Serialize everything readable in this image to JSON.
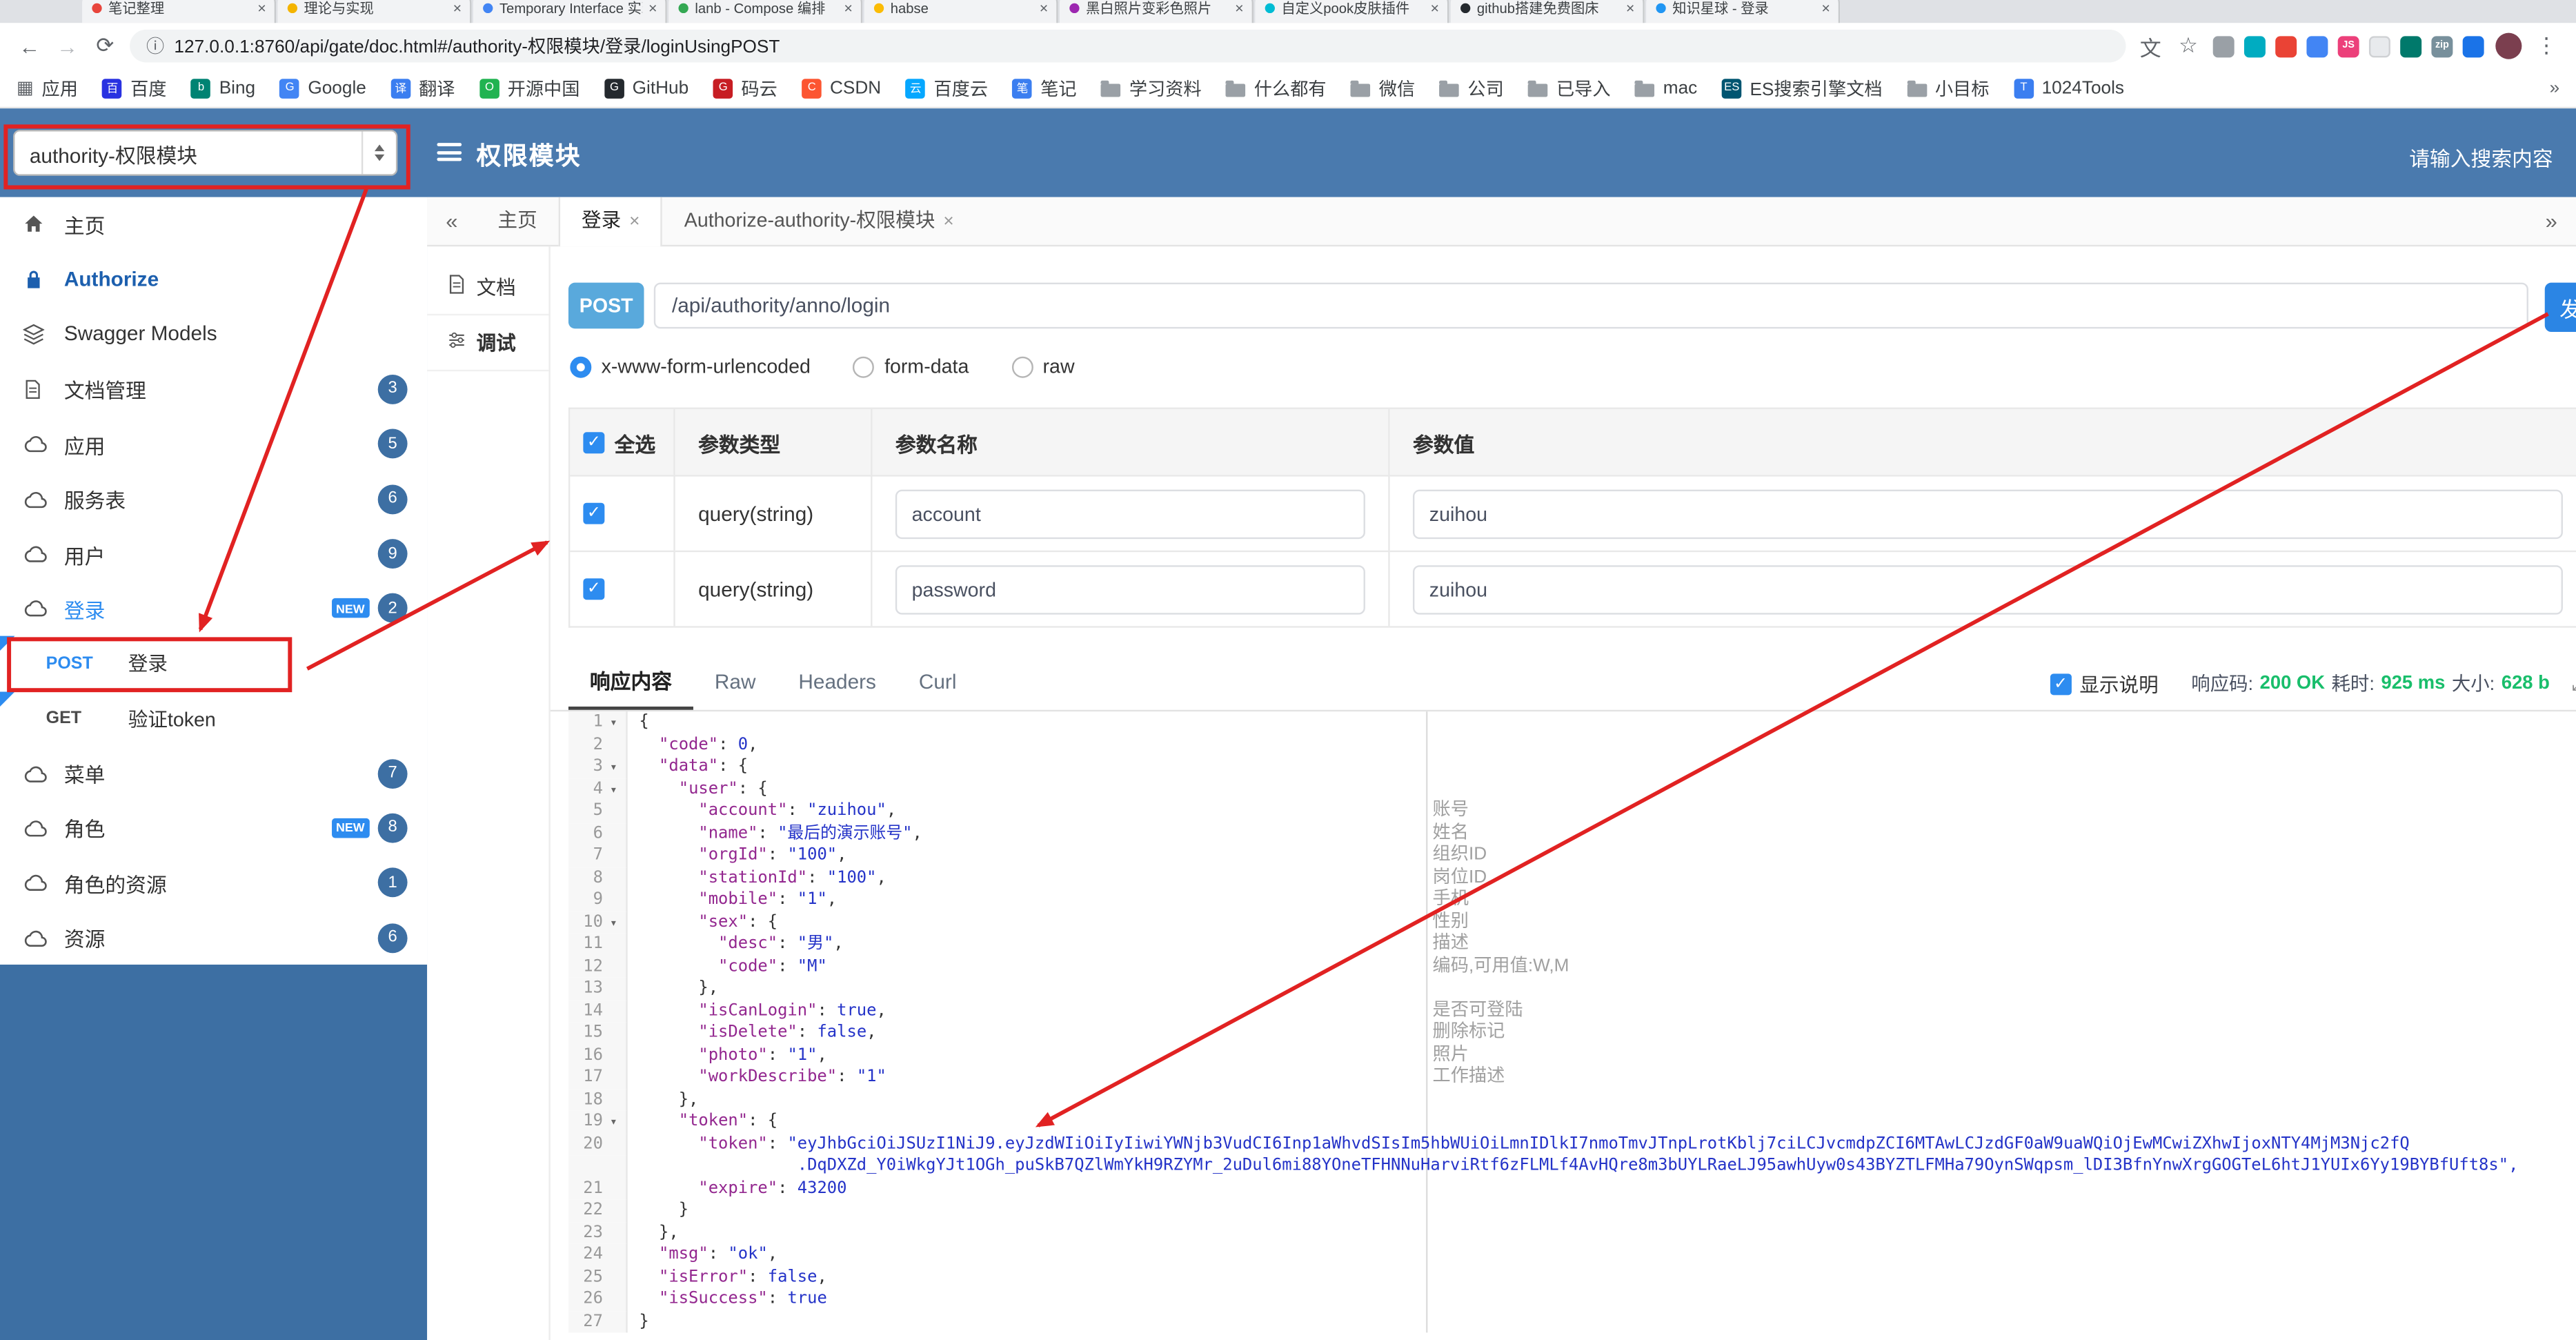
{
  "colors": {
    "accent": "#2d8cf0",
    "header_blue": "#4a7aae",
    "badge_blue": "#3d6fa3",
    "post_badge": "#59a9dc",
    "success_green": "#19be6b",
    "annotation_red": "#e12222"
  },
  "browser": {
    "tabs": [
      {
        "title": "笔记整理",
        "color": "#e8453c"
      },
      {
        "title": "理论与实现",
        "color": "#f4b400"
      },
      {
        "title": "Temporary Interface 实现",
        "color": "#4285f4"
      },
      {
        "title": "lanb - Compose 编排",
        "color": "#34a853"
      },
      {
        "title": "habse",
        "color": "#fbbc05"
      },
      {
        "title": "黑白照片变彩色照片",
        "color": "#9c27b0"
      },
      {
        "title": "自定义pook皮肤插件",
        "color": "#00bcd4"
      },
      {
        "title": "github搭建免费图床",
        "color": "#24292e"
      },
      {
        "title": "知识星球 - 登录",
        "color": "#2196f3"
      }
    ],
    "url": "127.0.0.1:8760/api/gate/doc.html#/authority-权限模块/登录/loginUsingPOST",
    "extensions": [
      {
        "color": "#9aa0a6"
      },
      {
        "color": "#00acc1"
      },
      {
        "color": "#ea4335"
      },
      {
        "color": "#4285f4"
      },
      {
        "color": "#ec407a",
        "label": "JS"
      },
      {
        "color": "#e8eaed"
      },
      {
        "color": "#00796b"
      },
      {
        "color": "#78909c",
        "label": "zip"
      },
      {
        "color": "#1a73e8"
      }
    ],
    "bookmarks": [
      {
        "label": "应用",
        "icon": "apps"
      },
      {
        "label": "百度",
        "icon": "site",
        "color": "#2932e1",
        "letter": "百"
      },
      {
        "label": "Bing",
        "icon": "site",
        "color": "#008373",
        "letter": "b"
      },
      {
        "label": "Google",
        "icon": "site",
        "color": "#4285f4",
        "letter": "G"
      },
      {
        "label": "翻译",
        "icon": "site",
        "color": "#3b7ef0",
        "letter": "译"
      },
      {
        "label": "开源中国",
        "icon": "site",
        "color": "#21b351",
        "letter": "O"
      },
      {
        "label": "GitHub",
        "icon": "site",
        "color": "#24292e",
        "letter": "G"
      },
      {
        "label": "码云",
        "icon": "site",
        "color": "#c71d23",
        "letter": "G"
      },
      {
        "label": "CSDN",
        "icon": "site",
        "color": "#fc5531",
        "letter": "C"
      },
      {
        "label": "百度云",
        "icon": "site",
        "color": "#06a7ff",
        "letter": "云"
      },
      {
        "label": "笔记",
        "icon": "site",
        "color": "#3b7ef0",
        "letter": "笔"
      },
      {
        "label": "学习资料",
        "icon": "folder"
      },
      {
        "label": "什么都有",
        "icon": "folder"
      },
      {
        "label": "微信",
        "icon": "folder"
      },
      {
        "label": "公司",
        "icon": "folder"
      },
      {
        "label": "已导入",
        "icon": "folder"
      },
      {
        "label": "mac",
        "icon": "folder"
      },
      {
        "label": "ES搜索引擎文档",
        "icon": "site",
        "color": "#005571",
        "letter": "ES"
      },
      {
        "label": "小目标",
        "icon": "folder"
      },
      {
        "label": "1024Tools",
        "icon": "site",
        "color": "#3b7ef0",
        "letter": "T"
      }
    ]
  },
  "header": {
    "module_select": "authority-权限模块",
    "title": "权限模块",
    "search_placeholder": "请输入搜索内容"
  },
  "sidebar": {
    "items": [
      {
        "label": "主页",
        "icon": "home"
      },
      {
        "label": "Authorize",
        "icon": "auth",
        "emph": true
      },
      {
        "label": "Swagger Models",
        "icon": "models"
      },
      {
        "label": "文档管理",
        "icon": "doc",
        "badge": "3"
      },
      {
        "label": "应用",
        "icon": "cloud",
        "badge": "5"
      },
      {
        "label": "服务表",
        "icon": "cloud",
        "badge": "6"
      },
      {
        "label": "用户",
        "icon": "cloud",
        "badge": "9"
      },
      {
        "label": "登录",
        "icon": "cloud",
        "badge": "2",
        "new": true,
        "active": true
      },
      {
        "child": true,
        "method": "POST",
        "label": "登录"
      },
      {
        "child": true,
        "method": "GET",
        "label": "验证token"
      },
      {
        "label": "菜单",
        "icon": "cloud",
        "badge": "7"
      },
      {
        "label": "角色",
        "icon": "cloud",
        "badge": "8",
        "new": true
      },
      {
        "label": "角色的资源",
        "icon": "cloud",
        "badge": "1"
      },
      {
        "label": "资源",
        "icon": "cloud",
        "badge": "6"
      }
    ]
  },
  "doc_tabs": {
    "scroll_left": "«",
    "scroll_right": "»",
    "tabs": [
      {
        "label": "主页"
      },
      {
        "label": "登录",
        "closable": true,
        "active": true
      },
      {
        "label": "Authorize-authority-权限模块",
        "closable": true
      }
    ]
  },
  "mini_sidebar": {
    "doc_label": "文档",
    "debug_label": "调试"
  },
  "request": {
    "method": "POST",
    "path": "/api/authority/anno/login",
    "send_label": "发送",
    "content_types": [
      {
        "label": "x-www-form-urlencoded",
        "selected": true
      },
      {
        "label": "form-data",
        "selected": false
      },
      {
        "label": "raw",
        "selected": false
      }
    ]
  },
  "params_table": {
    "select_all_label": "全选",
    "columns": [
      "参数类型",
      "参数名称",
      "参数值"
    ],
    "rows": [
      {
        "checked": true,
        "type": "query(string)",
        "name": "account",
        "value": "zuihou"
      },
      {
        "checked": true,
        "type": "query(string)",
        "name": "password",
        "value": "zuihou"
      }
    ]
  },
  "response": {
    "tabs": [
      {
        "label": "响应内容",
        "active": true
      },
      {
        "label": "Raw"
      },
      {
        "label": "Headers"
      },
      {
        "label": "Curl"
      }
    ],
    "show_desc_label": "显示说明",
    "meta": {
      "code_label": "响应码:",
      "code_value": "200 OK",
      "time_label": "耗时:",
      "time_value": "925 ms",
      "size_label": "大小:",
      "size_value": "628 b"
    }
  },
  "editor": {
    "lines": [
      {
        "n": 1,
        "fold": true,
        "text": "{"
      },
      {
        "n": 2,
        "text": "  \"code\": 0,"
      },
      {
        "n": 3,
        "fold": true,
        "text": "  \"data\": {"
      },
      {
        "n": 4,
        "fold": true,
        "text": "    \"user\": {"
      },
      {
        "n": 5,
        "text": "      \"account\": \"zuihou\",",
        "note": "账号"
      },
      {
        "n": 6,
        "text": "      \"name\": \"最后的演示账号\",",
        "note": "姓名"
      },
      {
        "n": 7,
        "text": "      \"orgId\": \"100\",",
        "note": "组织ID"
      },
      {
        "n": 8,
        "text": "      \"stationId\": \"100\",",
        "note": "岗位ID"
      },
      {
        "n": 9,
        "text": "      \"mobile\": \"1\",",
        "note": "手机"
      },
      {
        "n": 10,
        "fold": true,
        "text": "      \"sex\": {",
        "note": "性别"
      },
      {
        "n": 11,
        "text": "        \"desc\": \"男\",",
        "note": "描述"
      },
      {
        "n": 12,
        "text": "        \"code\": \"M\"",
        "note": "编码,可用值:W,M"
      },
      {
        "n": 13,
        "text": "      },"
      },
      {
        "n": 14,
        "text": "      \"isCanLogin\": true,",
        "note": "是否可登陆"
      },
      {
        "n": 15,
        "text": "      \"isDelete\": false,",
        "note": "删除标记"
      },
      {
        "n": 16,
        "text": "      \"photo\": \"1\",",
        "note": "照片"
      },
      {
        "n": 17,
        "text": "      \"workDescribe\": \"1\"",
        "note": "工作描述"
      },
      {
        "n": 18,
        "text": "    },"
      },
      {
        "n": 19,
        "fold": true,
        "text": "    \"token\": {"
      },
      {
        "n": 20,
        "text": "      \"token\": \"eyJhbGciOiJSUzI1NiJ9.eyJzdWIiOiIyIiwiYWNjb3VudCI6Inp1aWhvdSIsIm5hbWUiOiLmnIDlkI7nmoTmvJTnpLrotKblj7ciLCJvcmdpZCI6MTAwLCJzdGF0aW9uaWQiOjEwMCwiZXhwIjoxNTY4MjM3Njc2fQ"
      },
      {
        "wrap": true,
        "text": "                .DqDXZd_Y0iWkgYJt1OGh_puSkB7QZlWmYkH9RZYMr_2uDul6mi88YOneTFHNNuHarviRtf6zFLMLf4AvHQre8m3bUYLRaeLJ95awhUyw0s43BYZTLFMHa79OynSWqpsm_lDI3BfnYnwXrgGOGTeL6htJ1YUIx6Yy19BYBfUft8s\","
      },
      {
        "n": 21,
        "text": "      \"expire\": 43200"
      },
      {
        "n": 22,
        "text": "    }"
      },
      {
        "n": 23,
        "text": "  },"
      },
      {
        "n": 24,
        "text": "  \"msg\": \"ok\","
      },
      {
        "n": 25,
        "text": "  \"isError\": false,"
      },
      {
        "n": 26,
        "text": "  \"isSuccess\": true"
      },
      {
        "n": 27,
        "text": "}"
      }
    ]
  }
}
